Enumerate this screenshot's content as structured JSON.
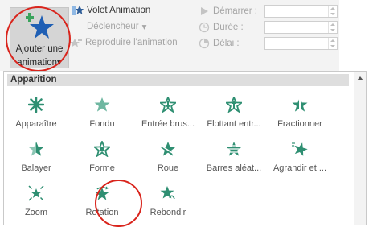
{
  "ribbon": {
    "add_animation": {
      "line1": "Ajouter une",
      "line2": "animation",
      "dropdown": "▾",
      "icon": "add-animation-star-icon"
    },
    "volet_animation": {
      "label": "Volet Animation",
      "icon": "animation-pane-icon"
    },
    "declencheur": {
      "label": "Déclencheur",
      "dropdown": "▾",
      "icon": "trigger-icon"
    },
    "reproduire": {
      "label": "Reproduire l'animation",
      "icon": "animation-painter-icon"
    },
    "demarrer": {
      "label": "Démarrer :",
      "value": "",
      "icon": "start-play-icon"
    },
    "duree": {
      "label": "Durée :",
      "value": "",
      "icon": "clock-icon"
    },
    "delai": {
      "label": "Délai :",
      "value": "",
      "icon": "delay-icon"
    }
  },
  "gallery": {
    "section_title": "Apparition",
    "rows": [
      [
        {
          "label": "Apparaître",
          "icon": "appear-icon"
        },
        {
          "label": "Fondu",
          "icon": "fade-icon"
        },
        {
          "label": "Entrée brus...",
          "icon": "fly-in-icon"
        },
        {
          "label": "Flottant entr...",
          "icon": "float-in-icon"
        },
        {
          "label": "Fractionner",
          "icon": "split-icon"
        }
      ],
      [
        {
          "label": "Balayer",
          "icon": "wipe-icon"
        },
        {
          "label": "Forme",
          "icon": "shape-icon"
        },
        {
          "label": "Roue",
          "icon": "wheel-icon"
        },
        {
          "label": "Barres aléat...",
          "icon": "random-bars-icon"
        },
        {
          "label": "Agrandir et ...",
          "icon": "grow-turn-icon"
        }
      ],
      [
        {
          "label": "Zoom",
          "icon": "zoom-icon"
        },
        {
          "label": "Rotation",
          "icon": "swivel-icon"
        },
        {
          "label": "Rebondir",
          "icon": "bounce-icon"
        }
      ]
    ]
  },
  "colors": {
    "star_green": "#2f8f72",
    "highlight_red": "#d9241c",
    "star_blue": "#1f5fb4"
  }
}
